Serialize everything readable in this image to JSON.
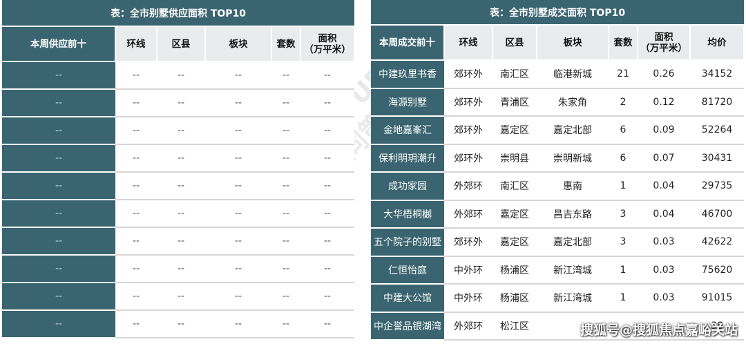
{
  "left_table": {
    "title": "表：全市别墅供应面积 TOP10",
    "headers": [
      "本周供应前十",
      "环线",
      "区县",
      "板块",
      "套数",
      "面积\n（万平米）"
    ],
    "rows": [
      [
        "--",
        "--",
        "--",
        "--",
        "--",
        "--"
      ],
      [
        "--",
        "--",
        "--",
        "--",
        "--",
        "--"
      ],
      [
        "--",
        "--",
        "--",
        "--",
        "--",
        "--"
      ],
      [
        "--",
        "--",
        "--",
        "--",
        "--",
        "--"
      ],
      [
        "--",
        "--",
        "--",
        "--",
        "--",
        "--"
      ],
      [
        "--",
        "--",
        "--",
        "--",
        "--",
        "--"
      ],
      [
        "--",
        "--",
        "--",
        "--",
        "--",
        "--"
      ],
      [
        "--",
        "--",
        "--",
        "--",
        "--",
        "--"
      ],
      [
        "--",
        "--",
        "--",
        "--",
        "--",
        "--"
      ],
      [
        "--",
        "--",
        "--",
        "--",
        "--",
        "--"
      ]
    ]
  },
  "right_table": {
    "title": "表：全市别墅成交面积 TOP10",
    "headers": [
      "本周成交前十",
      "环线",
      "区县",
      "板块",
      "套数",
      "面积\n（万平米）",
      "均价"
    ],
    "rows": [
      [
        "中建玖里书香",
        "郊环外",
        "南汇区",
        "临港新城",
        "21",
        "0.26",
        "34152"
      ],
      [
        "海源别墅",
        "郊环外",
        "青浦区",
        "朱家角",
        "2",
        "0.12",
        "81720"
      ],
      [
        "金地嘉峯汇",
        "郊环外",
        "嘉定区",
        "嘉定北部",
        "6",
        "0.09",
        "52264"
      ],
      [
        "保利明玥潮升",
        "郊环外",
        "崇明县",
        "崇明新城",
        "6",
        "0.07",
        "30431"
      ],
      [
        "成功家园",
        "外郊环",
        "南汇区",
        "惠南",
        "1",
        "0.04",
        "29735"
      ],
      [
        "大华梧桐樾",
        "外郊环",
        "嘉定区",
        "昌吉东路",
        "3",
        "0.04",
        "46700"
      ],
      [
        "五个院子的别墅",
        "郊环外",
        "嘉定区",
        "嘉定北部",
        "3",
        "0.03",
        "42622"
      ],
      [
        "仁恒怡庭",
        "中外环",
        "杨浦区",
        "新江湾城",
        "1",
        "0.03",
        "75620"
      ],
      [
        "中建大公馆",
        "中外环",
        "杨浦区",
        "新江湾城",
        "1",
        "0.03",
        "91015"
      ],
      [
        "中企誉品银湖湾",
        "外郊环",
        "松江区",
        "",
        "",
        "",
        "38"
      ]
    ]
  },
  "watermark_text": "TOSPUR 同策",
  "footer_watermark": "搜狐号@搜狐焦点嘉峪关站"
}
